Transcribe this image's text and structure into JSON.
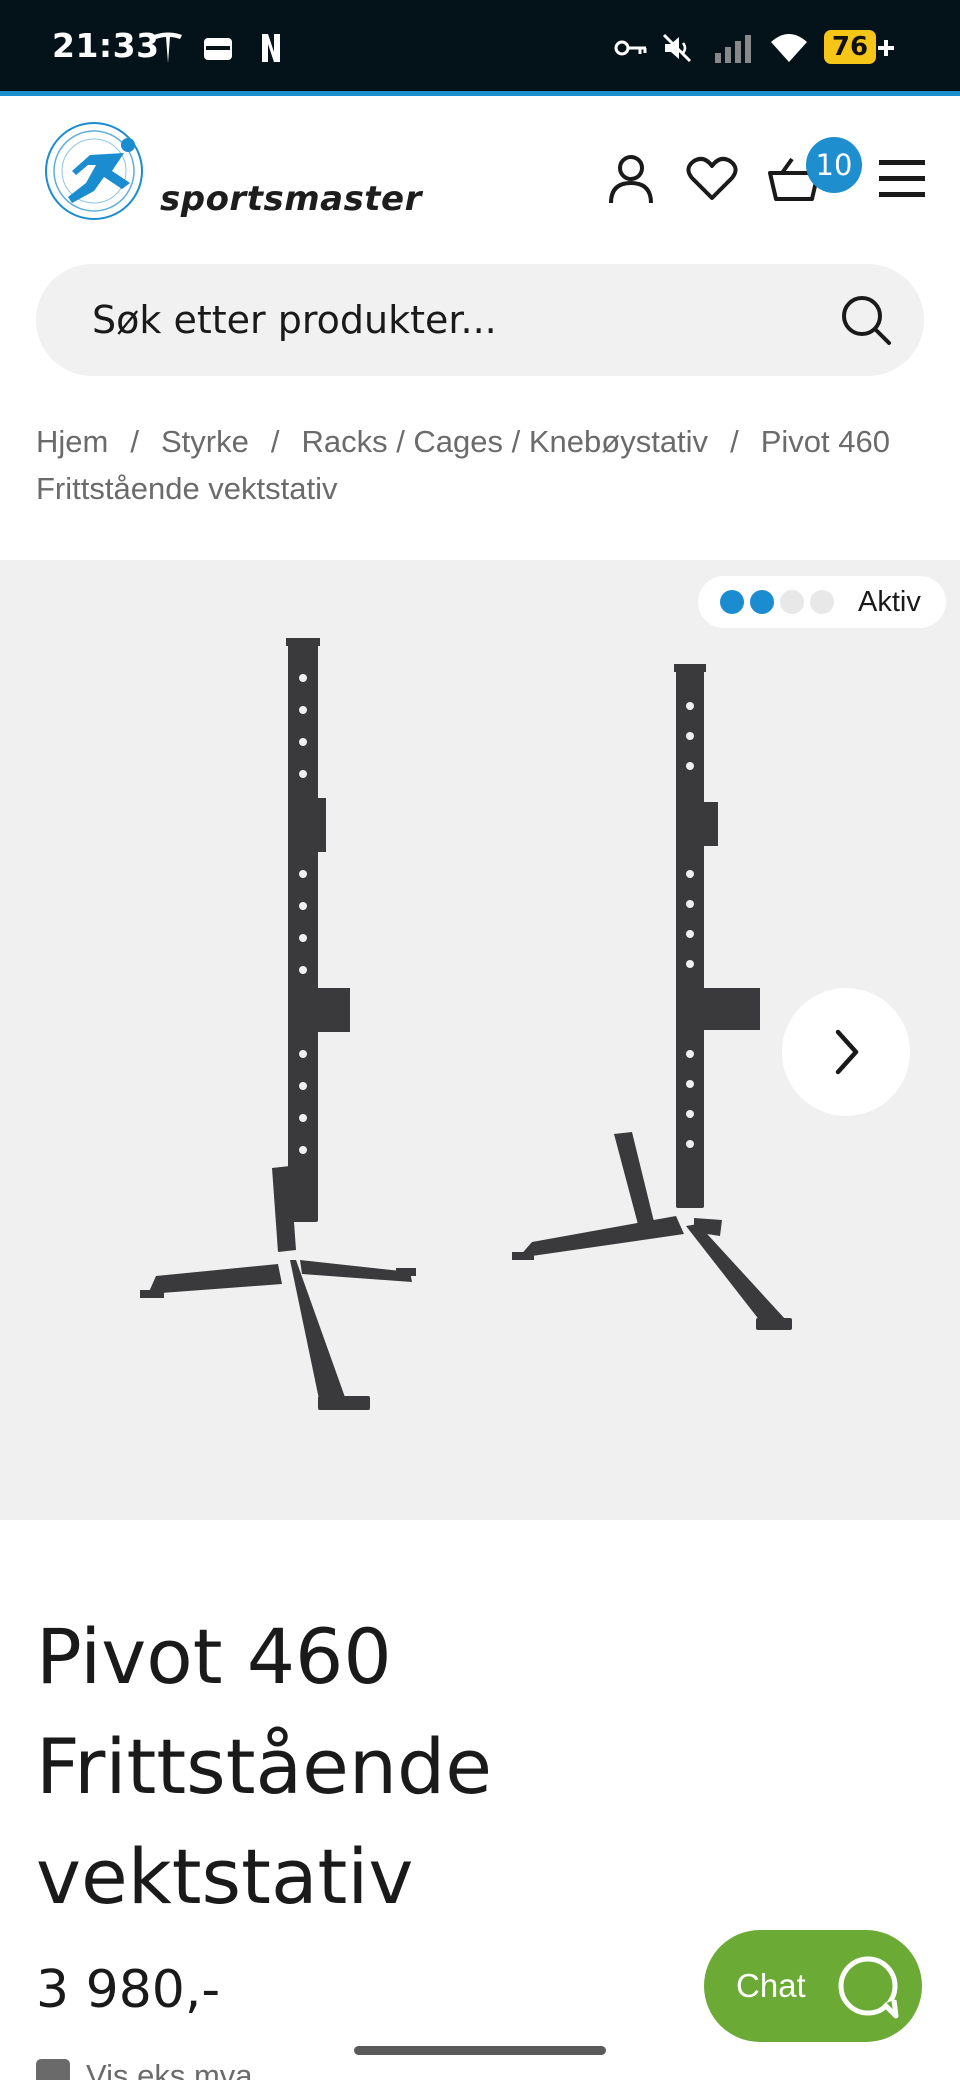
{
  "status_bar": {
    "time": "21:33",
    "battery": "76",
    "icons": [
      "tesla-icon",
      "wallet-icon",
      "netflix-icon",
      "key-icon",
      "mute-icon",
      "signal-icon",
      "wifi-icon",
      "battery-icon"
    ]
  },
  "header": {
    "logo_text": "sportsmaster",
    "cart_count": "10",
    "icons": [
      "account-icon",
      "heart-icon",
      "cart-icon",
      "menu-icon"
    ]
  },
  "search": {
    "placeholder": "Søk etter produkter..."
  },
  "breadcrumb": {
    "items": [
      "Hjem",
      "Styrke",
      "Racks / Cages / Knebøystativ",
      "Pivot 460 Frittstående vektstativ"
    ],
    "separator": "/"
  },
  "gallery": {
    "activity_label": "Aktiv",
    "activity_level": 2,
    "activity_max": 4,
    "accent_color": "#1a8ccf"
  },
  "product": {
    "title": "Pivot 460 Frittstående vektstativ",
    "price": "3 980,-",
    "vat_toggle_label": "Vis eks mva"
  },
  "chat": {
    "label": "Chat",
    "color": "#6aaa35"
  }
}
